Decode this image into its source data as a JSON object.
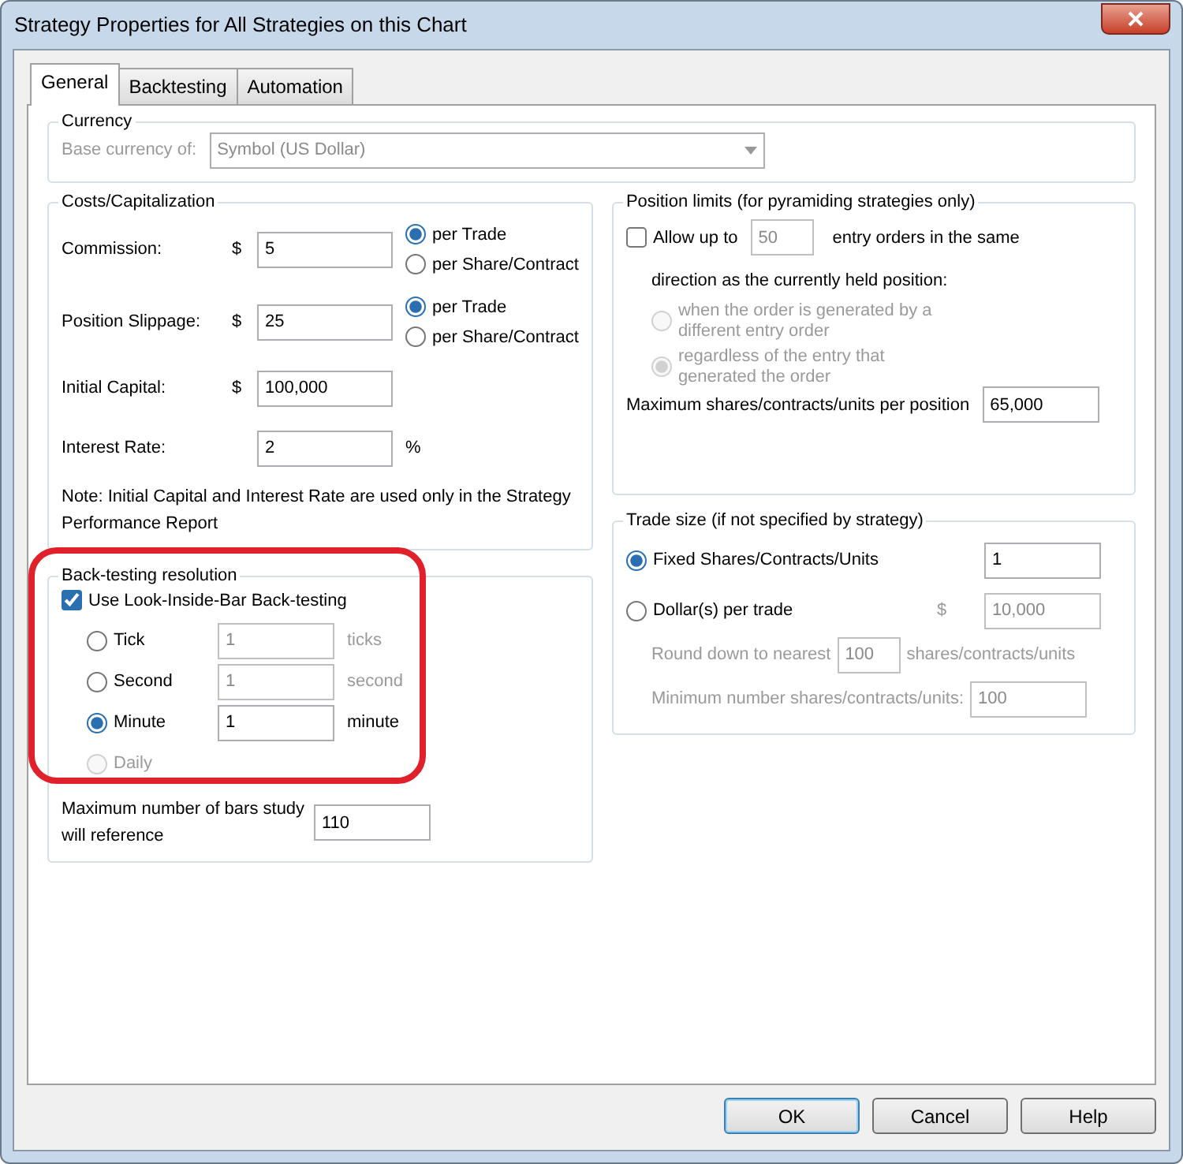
{
  "window": {
    "title": "Strategy Properties for All Strategies on this Chart"
  },
  "tabs": [
    {
      "label": "General",
      "selected": true
    },
    {
      "label": "Backtesting",
      "selected": false
    },
    {
      "label": "Automation",
      "selected": false
    }
  ],
  "currency": {
    "title": "Currency",
    "label": "Base currency of:",
    "value": "Symbol (US Dollar)",
    "disabled": true
  },
  "costs": {
    "title": "Costs/Capitalization",
    "rows": [
      {
        "label": "Commission:",
        "prefix": "$",
        "value": "5",
        "options": [
          {
            "label": "per Trade",
            "selected": true
          },
          {
            "label": "per Share/Contract",
            "selected": false
          }
        ]
      },
      {
        "label": "Position Slippage:",
        "prefix": "$",
        "value": "25",
        "options": [
          {
            "label": "per Trade",
            "selected": true
          },
          {
            "label": "per Share/Contract",
            "selected": false
          }
        ]
      },
      {
        "label": "Initial Capital:",
        "prefix": "$",
        "value": "100,000"
      },
      {
        "label": "Interest Rate:",
        "value": "2",
        "suffix": "%"
      }
    ],
    "note": "Note: Initial Capital and Interest Rate are used only in the Strategy Performance Report"
  },
  "backtesting": {
    "title": "Back-testing resolution",
    "use_lib": {
      "label": "Use Look-Inside-Bar Back-testing",
      "checked": true
    },
    "options": [
      {
        "label": "Tick",
        "selected": false,
        "disabled": false,
        "value": "1",
        "unit": "ticks",
        "field_disabled": true
      },
      {
        "label": "Second",
        "selected": false,
        "disabled": false,
        "value": "1",
        "unit": "second",
        "field_disabled": true
      },
      {
        "label": "Minute",
        "selected": true,
        "disabled": false,
        "value": "1",
        "unit": "minute",
        "field_disabled": false
      },
      {
        "label": "Daily",
        "selected": false,
        "disabled": true
      }
    ],
    "max_bars": {
      "label": "Maximum number of bars study will reference",
      "value": "110"
    }
  },
  "position_limits": {
    "title": "Position limits (for pyramiding strategies only)",
    "allow": {
      "label": "Allow up to",
      "checked": false,
      "value": "50",
      "value_disabled": true,
      "suffix": "entry orders in the same"
    },
    "direction": "direction as the currently held position:",
    "options": [
      {
        "label": "when the order is generated by a different entry order",
        "selected": false,
        "disabled": true
      },
      {
        "label": "regardless of the entry that generated the order",
        "selected": true,
        "disabled": true
      }
    ],
    "max": {
      "label": "Maximum shares/contracts/units per position",
      "value": "65,000"
    }
  },
  "trade_size": {
    "title": "Trade size (if not specified by strategy)",
    "options": [
      {
        "label": "Fixed Shares/Contracts/Units",
        "selected": true,
        "value": "1",
        "field_disabled": false
      },
      {
        "label": "Dollar(s) per trade",
        "selected": false,
        "prefix": "$",
        "value": "10,000",
        "field_disabled": true
      }
    ],
    "round": {
      "label": "Round down to nearest",
      "value": "100",
      "suffix": "shares/contracts/units",
      "disabled": true
    },
    "minimum": {
      "label": "Minimum number shares/contracts/units:",
      "value": "100",
      "disabled": true
    }
  },
  "buttons": [
    {
      "label": "OK",
      "default": true
    },
    {
      "label": "Cancel",
      "default": false
    },
    {
      "label": "Help",
      "default": false
    }
  ]
}
